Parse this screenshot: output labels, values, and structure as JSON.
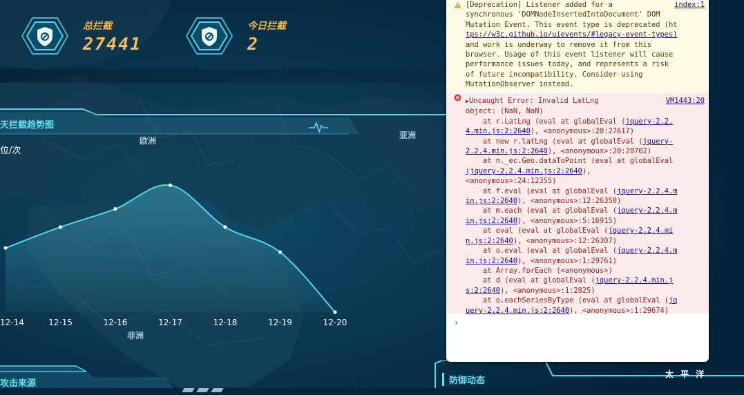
{
  "stats": {
    "total_label": "总拦截",
    "total_value": "27441",
    "today_label": "今日拦截",
    "today_value": "2",
    "accent_color": "#f5b94a",
    "icon": "shield-icon"
  },
  "trend_panel": {
    "title": "天拦截趋势图",
    "unit": "位/次",
    "pulse_icon": "pulse-icon"
  },
  "regions": {
    "europe": "欧洲",
    "asia": "亚洲",
    "africa": "非洲",
    "pacific": "太 平 洋"
  },
  "chart_data": {
    "type": "area",
    "categories": [
      "12-14",
      "12-15",
      "12-16",
      "12-17",
      "12-18",
      "12-19",
      "12-20"
    ],
    "series": [
      {
        "values": [
          0.46,
          0.61,
          0.74,
          0.91,
          0.61,
          0.43,
          0.0
        ]
      }
    ],
    "xlabel": "",
    "ylabel": "位/次",
    "ylim": [
      0,
      1
    ],
    "grid": false,
    "line_color": "#4fd8ee"
  },
  "bottom": {
    "left_title": "攻击来源",
    "right_title": "防御动态"
  },
  "console": {
    "warning": {
      "lines": [
        "[Deprecation] Listener added for a",
        "synchronous 'DOMNodeInsertedIntoDocument' DOM",
        "Mutation Event. This event type is deprecated (ht",
        "tps://w3c.github.io/uievents/#legacy-event-types)",
        "and work is underway to remove it from this",
        "browser. Usage of this event listener will cause",
        "performance issues today, and represents a risk",
        "of future incompatibility. Consider using",
        "MutationObserver instead."
      ],
      "source": "index:1"
    },
    "error": {
      "header": "Uncaught Error: Invalid LatLng",
      "lines": [
        "object: (NaN, NaN)",
        "    at r.LatLng (eval at globalEval (jquery-2.2.",
        "4.min.js:2:2640), <anonymous>:20:27617)",
        "    at new r.latLng (eval at globalEval (jquery-",
        "2.2.4.min.js:2:2640), <anonymous>:20:28702)",
        "    at n._ec.Geo.dataToPoint (eval at globalEval",
        "(jquery-2.2.4.min.js:2:2640),",
        "<anonymous>:24:12355)",
        "    at f.eval (eval at globalEval (jquery-2.2.4.m",
        "in.js:2:2640), <anonymous>:12:26350)",
        "    at m.each (eval at globalEval (jquery-2.2.4.m",
        "in.js:2:2640), <anonymous>:5:16915)",
        "    at eval (eval at globalEval (jquery-2.2.4.mi",
        "n.js:2:2640), <anonymous>:12:26307)",
        "    at o.eval (eval at globalEval (jquery-2.2.4.m",
        "in.js:2:2640), <anonymous>:1:29761)",
        "    at Array.forEach (<anonymous>)",
        "    at d (eval at globalEval (jquery-2.2.4.min.j",
        "s:2:2640), <anonymous>:1:2825)",
        "    at o.eachSeriesByType (eval at globalEval (jq",
        "uery-2.2.4.min.js:2:2640), <anonymous>:1:29674)"
      ],
      "source": "VM1443:20"
    },
    "prompt": "›"
  }
}
